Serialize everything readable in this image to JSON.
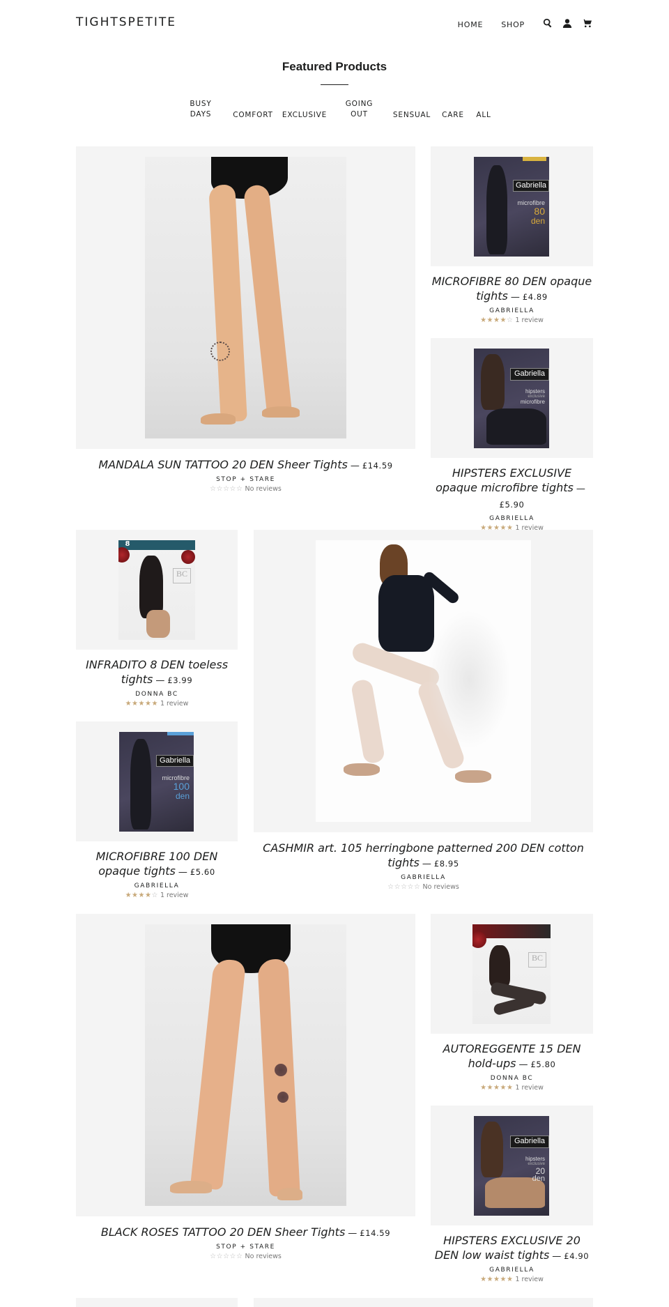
{
  "header": {
    "logo": "TIGHTSPETITE",
    "nav": [
      {
        "label": "HOME"
      },
      {
        "label": "SHOP"
      }
    ],
    "icons": [
      "search-icon",
      "account-icon",
      "cart-icon"
    ]
  },
  "section": {
    "title": "Featured Products",
    "filters": [
      {
        "line1": "BUSY",
        "line2": "DAYS"
      },
      {
        "line1": "COMFORT",
        "line2": ""
      },
      {
        "line1": "EXCLUSIVE",
        "line2": ""
      },
      {
        "line1": "GOING",
        "line2": "OUT"
      },
      {
        "line1": "SENSUAL",
        "line2": ""
      },
      {
        "line1": "CARE",
        "line2": ""
      },
      {
        "line1": "ALL",
        "line2": ""
      }
    ]
  },
  "products": [
    {
      "title": "MANDALA SUN TATTOO 20 DEN Sheer Tights",
      "sep": "—",
      "price": "£14.59",
      "vendor": "STOP + STARE",
      "stars_filled": 0,
      "rating_text": "No reviews",
      "stars_full": "",
      "stars_empty": "☆☆☆☆☆"
    },
    {
      "title": "MICROFIBRE 80 DEN opaque tights",
      "sep": "—",
      "price": "£4.89",
      "vendor": "GABRIELLA",
      "stars_filled": 4,
      "rating_text": "1 review",
      "stars_full": "★★★★",
      "stars_empty": "☆",
      "pack_brand": "Gabriella",
      "pack_line1": "microfibre",
      "pack_line2": "80",
      "pack_line3": "den"
    },
    {
      "title": "HIPSTERS EXCLUSIVE opaque microfibre tights",
      "sep": "—",
      "price": "£5.90",
      "vendor": "GABRIELLA",
      "stars_filled": 5,
      "rating_text": "1 review",
      "stars_full": "★★★★★",
      "stars_empty": "",
      "pack_brand": "Gabriella",
      "pack_line1": "hipsters",
      "pack_line2": "exclusive",
      "pack_line3": "microfibre"
    },
    {
      "title": "INFRADITO 8 DEN toeless tights",
      "sep": "—",
      "price": "£3.99",
      "vendor": "DONNA BC",
      "stars_filled": 5,
      "rating_text": "1 review",
      "stars_full": "★★★★★",
      "stars_empty": "",
      "pack_badge": "8",
      "pack_logo": "BC"
    },
    {
      "title": "CASHMIR art. 105 herringbone patterned 200 DEN cotton tights",
      "sep": "—",
      "price": "£8.95",
      "vendor": "GABRIELLA",
      "stars_filled": 0,
      "rating_text": "No reviews",
      "stars_full": "",
      "stars_empty": "☆☆☆☆☆"
    },
    {
      "title": "MICROFIBRE 100 DEN opaque tights",
      "sep": "—",
      "price": "£5.60",
      "vendor": "GABRIELLA",
      "stars_filled": 4,
      "rating_text": "1 review",
      "stars_full": "★★★★",
      "stars_empty": "☆",
      "pack_brand": "Gabriella",
      "pack_line1": "microfibre",
      "pack_line2": "100",
      "pack_line3": "den"
    },
    {
      "title": "BLACK ROSES TATTOO 20 DEN Sheer Tights",
      "sep": "—",
      "price": "£14.59",
      "vendor": "STOP + STARE",
      "stars_filled": 0,
      "rating_text": "No reviews",
      "stars_full": "",
      "stars_empty": "☆☆☆☆☆"
    },
    {
      "title": "AUTOREGGENTE 15 DEN hold-ups",
      "sep": "—",
      "price": "£5.80",
      "vendor": "DONNA BC",
      "stars_filled": 5,
      "rating_text": "1 review",
      "stars_full": "★★★★★",
      "stars_empty": "",
      "pack_logo": "BC"
    },
    {
      "title": "HIPSTERS EXCLUSIVE 20 DEN low waist tights",
      "sep": "—",
      "price": "£4.90",
      "vendor": "GABRIELLA",
      "stars_filled": 5,
      "rating_text": "1 review",
      "stars_full": "★★★★★",
      "stars_empty": "",
      "pack_brand": "Gabriella",
      "pack_line1": "hipsters",
      "pack_line2": "exclusive",
      "pack_line3": "20",
      "pack_line4": "den"
    }
  ],
  "colors": {
    "text": "#1c1d1d",
    "image_bg": "#f4f4f4",
    "star": "#c8a97a",
    "star_empty": "#b8b8b8"
  }
}
